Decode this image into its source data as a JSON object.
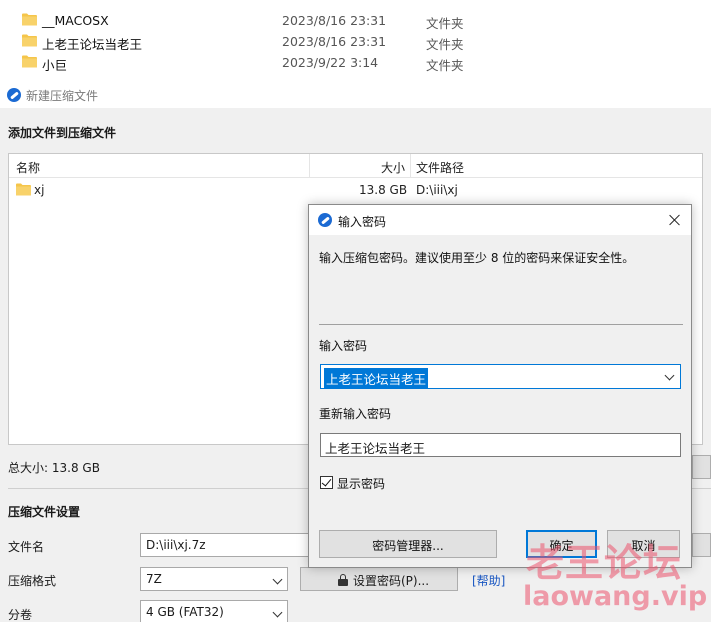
{
  "file_list": [
    {
      "name": "__MACOSX",
      "date": "2023/8/16 23:31",
      "type": "文件夹"
    },
    {
      "name": "上老王论坛当老王",
      "date": "2023/8/16 23:31",
      "type": "文件夹"
    },
    {
      "name": "小巨",
      "date": "2023/9/22 3:14",
      "type": "文件夹"
    }
  ],
  "app": {
    "title": "新建压缩文件",
    "add_section_title": "添加文件到压缩文件",
    "columns": {
      "name": "名称",
      "size": "大小",
      "path": "文件路径"
    },
    "rows": [
      {
        "name": "xj",
        "size": "13.8 GB",
        "path": "D:\\iii\\xj"
      }
    ],
    "total_size": "总大小: 13.8 GB",
    "settings_title": "压缩文件设置",
    "filename_label": "文件名",
    "filename_value": "D:\\iii\\xj.7z",
    "format_label": "压缩格式",
    "format_value": "7Z",
    "volume_label": "分卷",
    "volume_value": "4 GB (FAT32)",
    "set_password_button": "设置密码(P)...",
    "help_link": "[帮助]"
  },
  "dialog": {
    "title": "输入密码",
    "description": "输入压缩包密码。建议使用至少 8 位的密码来保证安全性。",
    "password_label": "输入密码",
    "password_value": "上老王论坛当老王",
    "confirm_label": "重新输入密码",
    "confirm_value": "上老王论坛当老王",
    "show_password_label": "显示密码",
    "show_password_checked": true,
    "manager_button": "密码管理器...",
    "ok_button": "确定",
    "cancel_button": "取消"
  },
  "watermark": {
    "chinese": "老王论坛",
    "domain": "laowang.vip"
  },
  "colors": {
    "accent": "#0078d7",
    "folder": "#f5c54a",
    "watermark": "#ec546e"
  }
}
